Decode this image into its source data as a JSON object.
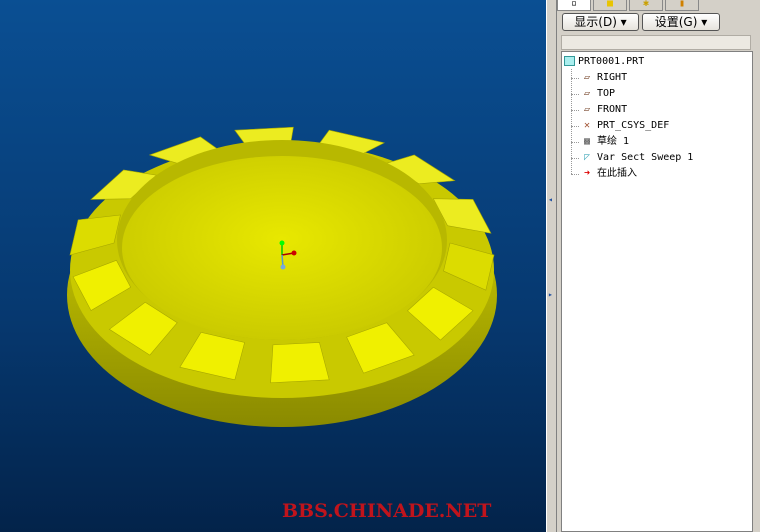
{
  "panel": {
    "tabs": [
      {
        "icon": "model-tree-icon"
      },
      {
        "icon": "folder-icon"
      },
      {
        "icon": "favorites-icon"
      },
      {
        "icon": "layers-icon"
      }
    ],
    "show_button": "显示(D) ▾",
    "settings_button": "设置(G) ▾",
    "tree": {
      "root": "PRT0001.PRT",
      "items": [
        {
          "label": "RIGHT",
          "icon": "datum-plane-icon"
        },
        {
          "label": "TOP",
          "icon": "datum-plane-icon"
        },
        {
          "label": "FRONT",
          "icon": "datum-plane-icon"
        },
        {
          "label": "PRT_CSYS_DEF",
          "icon": "csys-icon"
        },
        {
          "label": "草绘 1",
          "icon": "sketch-icon"
        },
        {
          "label": "Var Sect Sweep 1",
          "icon": "sweep-icon"
        },
        {
          "label": "在此插入",
          "icon": "insert-here-arrow-icon"
        }
      ]
    }
  },
  "watermark": "BBS.CHINADE.NET",
  "colors": {
    "model": "#e6e600",
    "background": "#0a4f93",
    "watermark": "#c0141c"
  }
}
